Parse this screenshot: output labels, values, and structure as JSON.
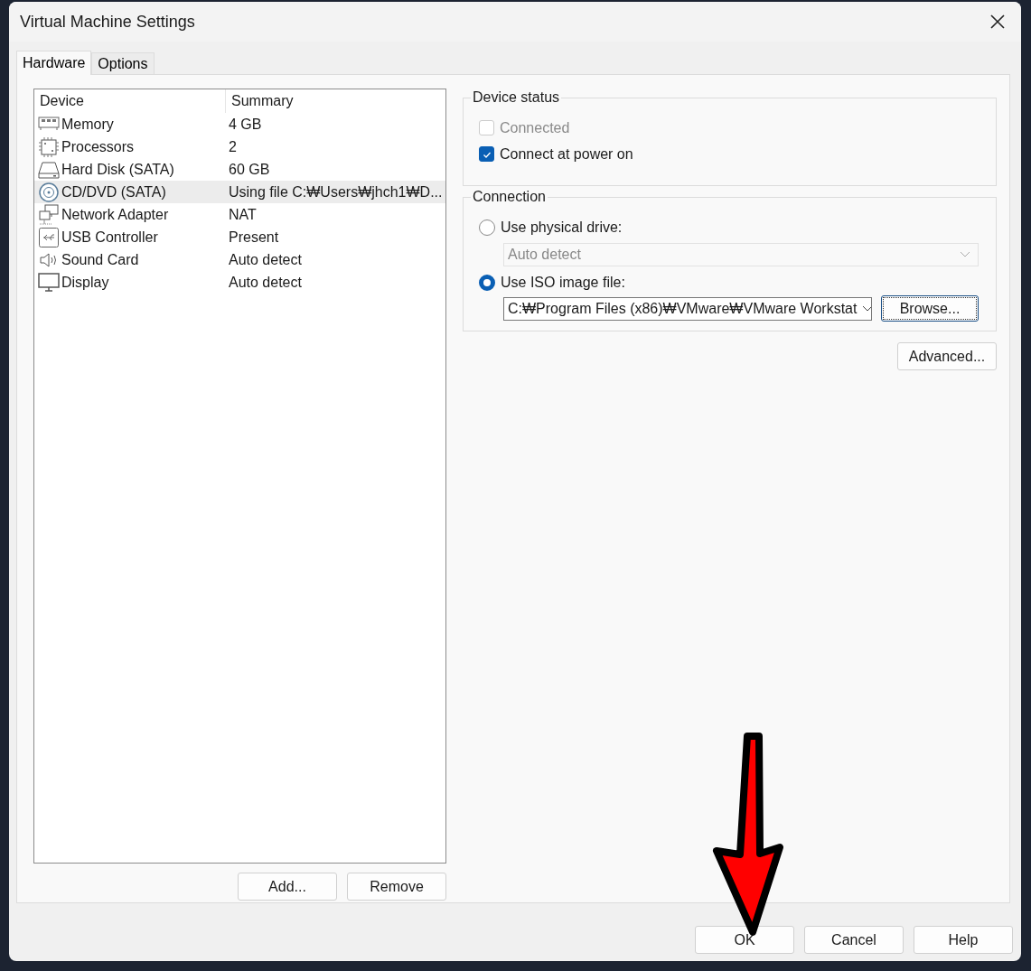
{
  "window": {
    "title": "Virtual Machine Settings"
  },
  "tabs": [
    {
      "label": "Hardware",
      "selected": true
    },
    {
      "label": "Options",
      "selected": false
    }
  ],
  "device_table": {
    "columns": [
      "Device",
      "Summary"
    ],
    "rows": [
      {
        "kind": "memory",
        "device": "Memory",
        "summary": "4 GB",
        "selected": false
      },
      {
        "kind": "processor",
        "device": "Processors",
        "summary": "2",
        "selected": false
      },
      {
        "kind": "disk",
        "device": "Hard Disk (SATA)",
        "summary": "60 GB",
        "selected": false
      },
      {
        "kind": "cd",
        "device": "CD/DVD (SATA)",
        "summary": "Using file C:₩Users₩jhch1₩D...",
        "selected": true
      },
      {
        "kind": "network",
        "device": "Network Adapter",
        "summary": "NAT",
        "selected": false
      },
      {
        "kind": "usb",
        "device": "USB Controller",
        "summary": "Present",
        "selected": false
      },
      {
        "kind": "sound",
        "device": "Sound Card",
        "summary": "Auto detect",
        "selected": false
      },
      {
        "kind": "display",
        "device": "Display",
        "summary": "Auto detect",
        "selected": false
      }
    ]
  },
  "device_buttons": [
    "Add...",
    "Remove"
  ],
  "device_status": {
    "title": "Device status",
    "options": [
      {
        "label": "Connected",
        "checked": false,
        "disabled": true
      },
      {
        "label": "Connect at power on",
        "checked": true,
        "disabled": false
      }
    ]
  },
  "connection": {
    "title": "Connection",
    "options": [
      {
        "label": "Use physical drive:",
        "selected": false,
        "dropdown": {
          "value": "Auto detect",
          "disabled": true
        }
      },
      {
        "label": "Use ISO image file:",
        "selected": true,
        "dropdown": {
          "value": "C:₩Program Files (x86)₩VMware₩VMware Workstat",
          "disabled": false
        },
        "button": "Browse..."
      }
    ]
  },
  "advanced_button": "Advanced...",
  "footer_buttons": [
    "OK",
    "Cancel",
    "Help"
  ]
}
